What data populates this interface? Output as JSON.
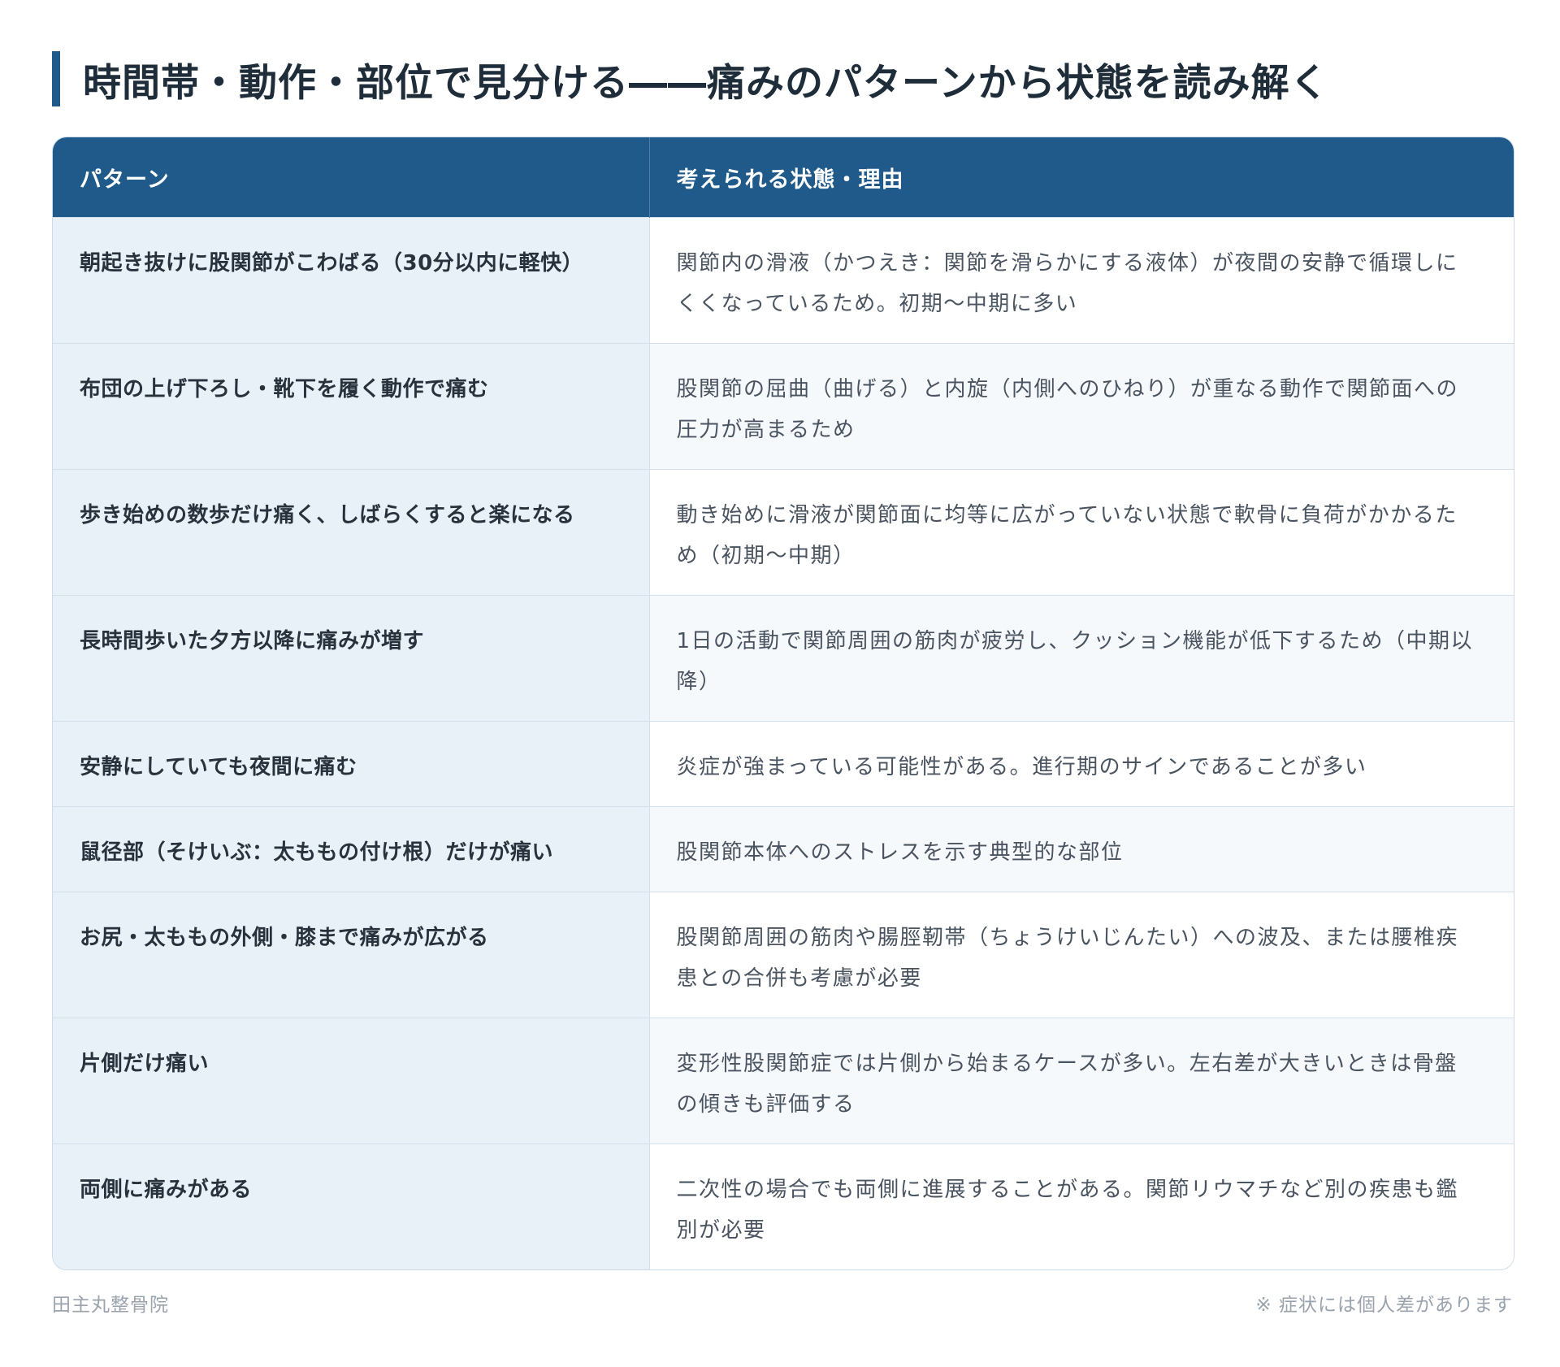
{
  "title": "時間帯・動作・部位で見分ける――痛みのパターンから状態を読み解く",
  "table": {
    "headers": [
      "パターン",
      "考えられる状態・理由"
    ],
    "rows": [
      {
        "pattern": "朝起き抜けに股関節がこわばる（30分以内に軽快）",
        "reason": "関節内の滑液（かつえき：関節を滑らかにする液体）が夜間の安静で循環しにくくなっているため。初期〜中期に多い"
      },
      {
        "pattern": "布団の上げ下ろし・靴下を履く動作で痛む",
        "reason": "股関節の屈曲（曲げる）と内旋（内側へのひねり）が重なる動作で関節面への圧力が高まるため"
      },
      {
        "pattern": "歩き始めの数歩だけ痛く、しばらくすると楽になる",
        "reason": "動き始めに滑液が関節面に均等に広がっていない状態で軟骨に負荷がかかるため（初期〜中期）"
      },
      {
        "pattern": "長時間歩いた夕方以降に痛みが増す",
        "reason": "1日の活動で関節周囲の筋肉が疲労し、クッション機能が低下するため（中期以降）"
      },
      {
        "pattern": "安静にしていても夜間に痛む",
        "reason": "炎症が強まっている可能性がある。進行期のサインであることが多い"
      },
      {
        "pattern": "鼠径部（そけいぶ：太ももの付け根）だけが痛い",
        "reason": "股関節本体へのストレスを示す典型的な部位"
      },
      {
        "pattern": "お尻・太ももの外側・膝まで痛みが広がる",
        "reason": "股関節周囲の筋肉や腸脛靭帯（ちょうけいじんたい）への波及、または腰椎疾患との合併も考慮が必要"
      },
      {
        "pattern": "片側だけ痛い",
        "reason": "変形性股関節症では片側から始まるケースが多い。左右差が大きいときは骨盤の傾きも評価する"
      },
      {
        "pattern": "両側に痛みがある",
        "reason": "二次性の場合でも両側に進展することがある。関節リウマチなど別の疾患も鑑別が必要"
      }
    ]
  },
  "footer": {
    "source": "田主丸整骨院",
    "note": "※ 症状には個人差があります"
  },
  "colors": {
    "header_bg": "#1f5a8a",
    "pattern_bg": "#e8f0f8",
    "accent_bar": "#1f5a8a"
  }
}
